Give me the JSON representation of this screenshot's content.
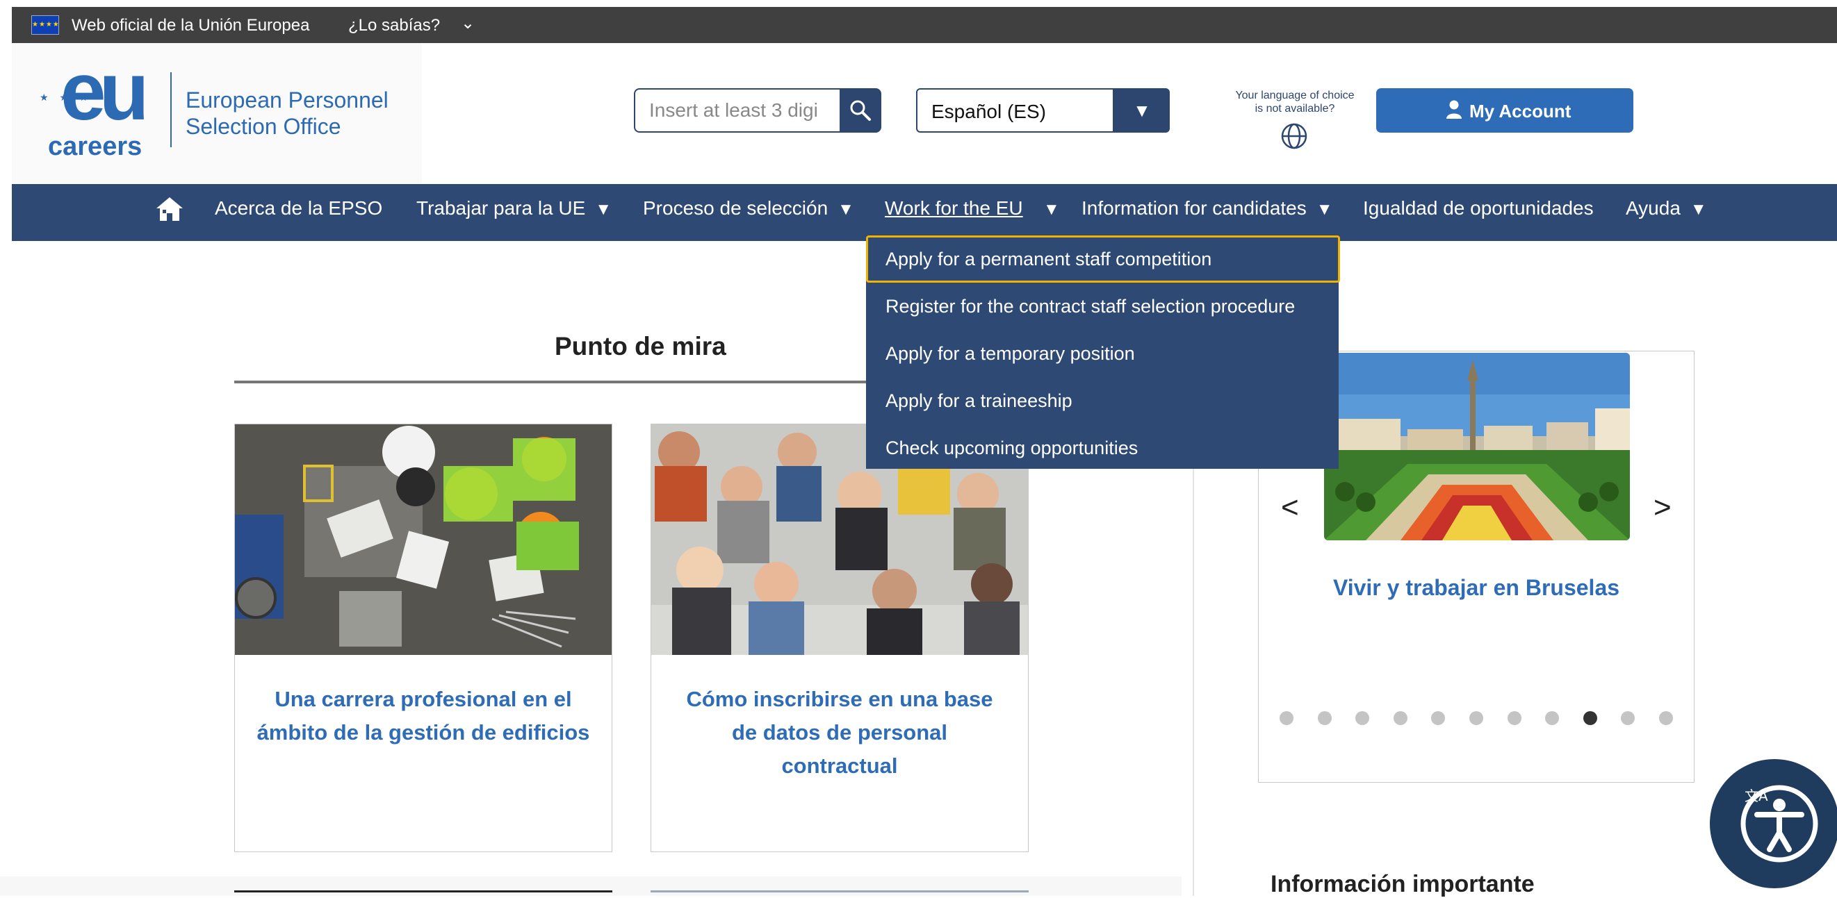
{
  "eu_bar": {
    "official_text": "Web oficial de la Unión Europea",
    "did_you_know": "¿Lo sabías?"
  },
  "logo": {
    "eu": "eu",
    "careers": "careers",
    "org_line1": "European Personnel",
    "org_line2": "Selection Office"
  },
  "search": {
    "placeholder": "Insert at least 3 digi"
  },
  "language": {
    "selected": "Español (ES)",
    "note_line1": "Your language of choice",
    "note_line2": "is not available?"
  },
  "account": {
    "label": "My Account"
  },
  "nav": {
    "items": [
      {
        "label": "Acerca de la EPSO"
      },
      {
        "label": "Trabajar para la UE"
      },
      {
        "label": "Proceso de selección"
      },
      {
        "label": "Work for the EU"
      },
      {
        "label": "Information for candidates"
      },
      {
        "label": "Igualdad de oportunidades"
      },
      {
        "label": "Ayuda"
      }
    ]
  },
  "dropdown": {
    "items": [
      {
        "label": "Apply for a permanent staff competition"
      },
      {
        "label": "Register for the contract staff selection procedure"
      },
      {
        "label": "Apply for a temporary position"
      },
      {
        "label": "Apply for a traineeship"
      },
      {
        "label": "Check upcoming opportunities"
      }
    ]
  },
  "spotlight": {
    "title": "Punto de mira",
    "cards": [
      {
        "title": "Una carrera profesional en el ámbito de la gestión de edificios"
      },
      {
        "title": "Cómo inscribirse en una base de datos de personal contractual"
      }
    ]
  },
  "carousel": {
    "caption": "Vivir y trabajar en Bruselas",
    "prev": "<",
    "next": ">",
    "dot_count": 11,
    "active_dot_index": 8
  },
  "important_info": {
    "title": "Información importante"
  },
  "colors": {
    "nav_bg": "#2e4a74",
    "brand_blue": "#2e6cb8",
    "focus_outline": "#f0b400",
    "top_bar": "#404040"
  },
  "icons": [
    "eu-flag-icon",
    "chevron-down-icon",
    "search-icon",
    "globe-icon",
    "user-icon",
    "home-icon",
    "accessibility-icon"
  ]
}
